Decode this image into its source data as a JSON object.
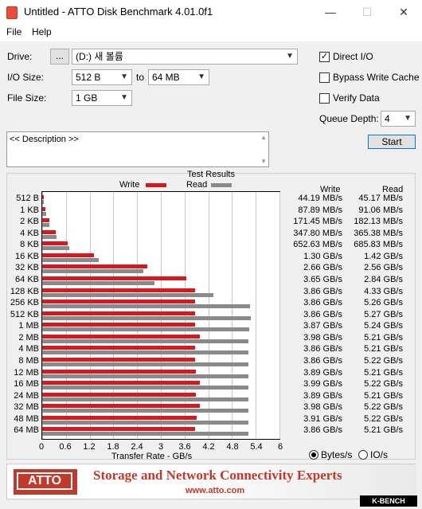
{
  "window": {
    "title": "Untitled - ATTO Disk Benchmark 4.01.0f1",
    "minimize": "—",
    "maximize": "☐",
    "close": "✕"
  },
  "menu": {
    "file": "File",
    "help": "Help"
  },
  "form": {
    "drive_label": "Drive:",
    "browse_label": "...",
    "drive_value": "(D:) 새 볼륨",
    "io_size_label": "I/O Size:",
    "io_size_from": "512 B",
    "io_to_label": "to",
    "io_size_to": "64 MB",
    "file_size_label": "File Size:",
    "file_size_value": "1 GB",
    "direct_io_label": "Direct I/O",
    "direct_io_checked": true,
    "bypass_label": "Bypass Write Cache",
    "verify_label": "Verify Data",
    "queue_label": "Queue Depth:",
    "queue_value": "4",
    "start_label": "Start",
    "description": "<< Description >>"
  },
  "results": {
    "title": "Test Results",
    "legend_write": "Write",
    "legend_read": "Read",
    "col_write": "Write",
    "col_read": "Read",
    "xlabel": "Transfer Rate - GB/s",
    "unit_bytes": "Bytes/s",
    "unit_io": "IO/s",
    "rows": [
      {
        "label": "512 B",
        "write_text": "44.19 MB/s",
        "read_text": "45.17 MB/s"
      },
      {
        "label": "1 KB",
        "write_text": "87.89 MB/s",
        "read_text": "91.06 MB/s"
      },
      {
        "label": "2 KB",
        "write_text": "171.45 MB/s",
        "read_text": "182.13 MB/s"
      },
      {
        "label": "4 KB",
        "write_text": "347.80 MB/s",
        "read_text": "365.38 MB/s"
      },
      {
        "label": "8 KB",
        "write_text": "652.63 MB/s",
        "read_text": "685.83 MB/s"
      },
      {
        "label": "16 KB",
        "write_text": "1.30 GB/s",
        "read_text": "1.42 GB/s"
      },
      {
        "label": "32 KB",
        "write_text": "2.66 GB/s",
        "read_text": "2.56 GB/s"
      },
      {
        "label": "64 KB",
        "write_text": "3.65 GB/s",
        "read_text": "2.84 GB/s"
      },
      {
        "label": "128 KB",
        "write_text": "3.86 GB/s",
        "read_text": "4.33 GB/s"
      },
      {
        "label": "256 KB",
        "write_text": "3.86 GB/s",
        "read_text": "5.26 GB/s"
      },
      {
        "label": "512 KB",
        "write_text": "3.86 GB/s",
        "read_text": "5.27 GB/s"
      },
      {
        "label": "1 MB",
        "write_text": "3.87 GB/s",
        "read_text": "5.24 GB/s"
      },
      {
        "label": "2 MB",
        "write_text": "3.98 GB/s",
        "read_text": "5.21 GB/s"
      },
      {
        "label": "4 MB",
        "write_text": "3.86 GB/s",
        "read_text": "5.21 GB/s"
      },
      {
        "label": "8 MB",
        "write_text": "3.86 GB/s",
        "read_text": "5.22 GB/s"
      },
      {
        "label": "12 MB",
        "write_text": "3.89 GB/s",
        "read_text": "5.21 GB/s"
      },
      {
        "label": "16 MB",
        "write_text": "3.99 GB/s",
        "read_text": "5.22 GB/s"
      },
      {
        "label": "24 MB",
        "write_text": "3.89 GB/s",
        "read_text": "5.21 GB/s"
      },
      {
        "label": "32 MB",
        "write_text": "3.98 GB/s",
        "read_text": "5.22 GB/s"
      },
      {
        "label": "48 MB",
        "write_text": "3.91 GB/s",
        "read_text": "5.22 GB/s"
      },
      {
        "label": "64 MB",
        "write_text": "3.86 GB/s",
        "read_text": "5.21 GB/s"
      }
    ]
  },
  "chart_data": {
    "type": "bar",
    "orientation": "horizontal",
    "title": "Test Results",
    "xlabel": "Transfer Rate - GB/s",
    "xlim": [
      0,
      6
    ],
    "xticks": [
      "0",
      "0.6",
      "1.2",
      "1.8",
      "2.4",
      "3",
      "3.6",
      "4.2",
      "4.8",
      "5.4",
      "6"
    ],
    "categories": [
      "512 B",
      "1 KB",
      "2 KB",
      "4 KB",
      "8 KB",
      "16 KB",
      "32 KB",
      "64 KB",
      "128 KB",
      "256 KB",
      "512 KB",
      "1 MB",
      "2 MB",
      "4 MB",
      "8 MB",
      "12 MB",
      "16 MB",
      "24 MB",
      "32 MB",
      "48 MB",
      "64 MB"
    ],
    "series": [
      {
        "name": "Write",
        "color": "#d4191f",
        "values": [
          0.04419,
          0.08789,
          0.17145,
          0.3478,
          0.65263,
          1.3,
          2.66,
          3.65,
          3.86,
          3.86,
          3.86,
          3.87,
          3.98,
          3.86,
          3.86,
          3.89,
          3.99,
          3.89,
          3.98,
          3.91,
          3.86
        ]
      },
      {
        "name": "Read",
        "color": "#8a8a8a",
        "values": [
          0.04517,
          0.09106,
          0.18213,
          0.36538,
          0.68583,
          1.42,
          2.56,
          2.84,
          4.33,
          5.26,
          5.27,
          5.24,
          5.21,
          5.21,
          5.22,
          5.21,
          5.22,
          5.21,
          5.22,
          5.22,
          5.21
        ]
      }
    ],
    "legend": "top-center",
    "grid": true
  },
  "banner": {
    "logo": "ATTO",
    "tagline": "Storage and Network Connectivity Experts",
    "url": "www.atto.com",
    "badge": "K-BENCH"
  }
}
